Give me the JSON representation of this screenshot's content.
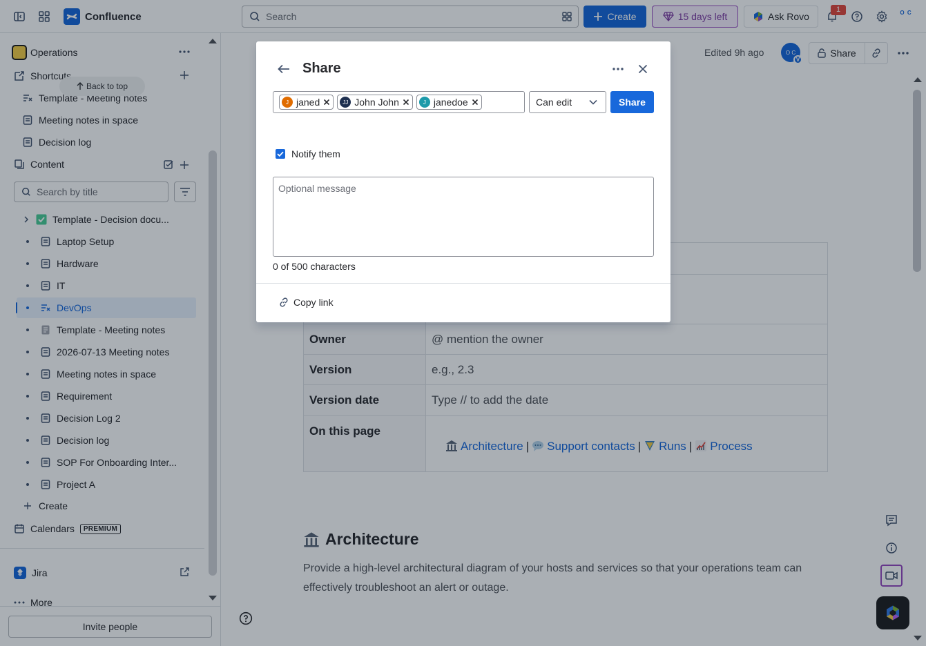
{
  "topbar": {
    "app_name": "Confluence",
    "search_placeholder": "Search",
    "create_label": "Create",
    "trial_label": "15 days left",
    "rovo_label": "Ask Rovo",
    "notification_count": "1",
    "avatar_initials": "O C",
    "accent_color": "#1868db"
  },
  "sidebar": {
    "space_name": "Operations",
    "shortcuts_label": "Shortcuts",
    "back_to_top": "Back to top",
    "shortcuts": [
      {
        "label": "Template - Meeting notes"
      },
      {
        "label": "Meeting notes in space"
      },
      {
        "label": "Decision log"
      }
    ],
    "content_label": "Content",
    "search_placeholder": "Search by title",
    "tree": [
      {
        "label": "Template - Decision docu...",
        "icon": "check-emoji-icon",
        "expandable": true
      },
      {
        "label": "Laptop Setup",
        "icon": "page-icon"
      },
      {
        "label": "Hardware",
        "icon": "page-icon"
      },
      {
        "label": "IT",
        "icon": "page-icon"
      },
      {
        "label": "DevOps",
        "icon": "live-doc-icon",
        "selected": true
      },
      {
        "label": "Template - Meeting notes",
        "icon": "template-icon"
      },
      {
        "label": "2026-07-13 Meeting notes",
        "icon": "page-icon"
      },
      {
        "label": "Meeting notes in space",
        "icon": "page-icon"
      },
      {
        "label": "Requirement",
        "icon": "page-icon"
      },
      {
        "label": "Decision Log 2",
        "icon": "page-icon"
      },
      {
        "label": "Decision log",
        "icon": "page-icon"
      },
      {
        "label": "SOP For Onboarding Inter...",
        "icon": "page-icon"
      },
      {
        "label": "Project A",
        "icon": "page-icon"
      }
    ],
    "create_label": "Create",
    "calendars_label": "Calendars",
    "premium_badge": "PREMIUM",
    "jira_label": "Jira",
    "more_label": "More",
    "invite_label": "Invite people"
  },
  "page": {
    "edited_label": "Edited 9h ago",
    "avatar_initials": "O C",
    "avatar_badge": "V",
    "share_label": "Share",
    "table": [
      {
        "key": "Owner",
        "value": "@ mention the owner"
      },
      {
        "key": "Version",
        "value": "e.g., 2.3"
      },
      {
        "key": "Version date",
        "value": "Type // to add the date"
      }
    ],
    "toc_key": "On this page",
    "toc_links": [
      "Architecture",
      "Support contacts",
      "Runs",
      "Process"
    ],
    "arch_heading": "Architecture",
    "arch_text": "Provide a high-level architectural diagram of your hosts and services so that your operations team can effectively troubleshoot an alert or outage."
  },
  "share_modal": {
    "title": "Share",
    "recipients": [
      {
        "name": "janed",
        "initial": "J",
        "color": "#e06c00"
      },
      {
        "name": "John John",
        "initial": "JJ",
        "color": "#1d2f4f"
      },
      {
        "name": "janedoe",
        "initial": "J",
        "color": "#1d9aaa"
      }
    ],
    "permission": "Can edit",
    "share_button": "Share",
    "notify_label": "Notify them",
    "notify_checked": true,
    "message_placeholder": "Optional message",
    "char_count": "0 of 500 characters",
    "copy_link_label": "Copy link"
  }
}
